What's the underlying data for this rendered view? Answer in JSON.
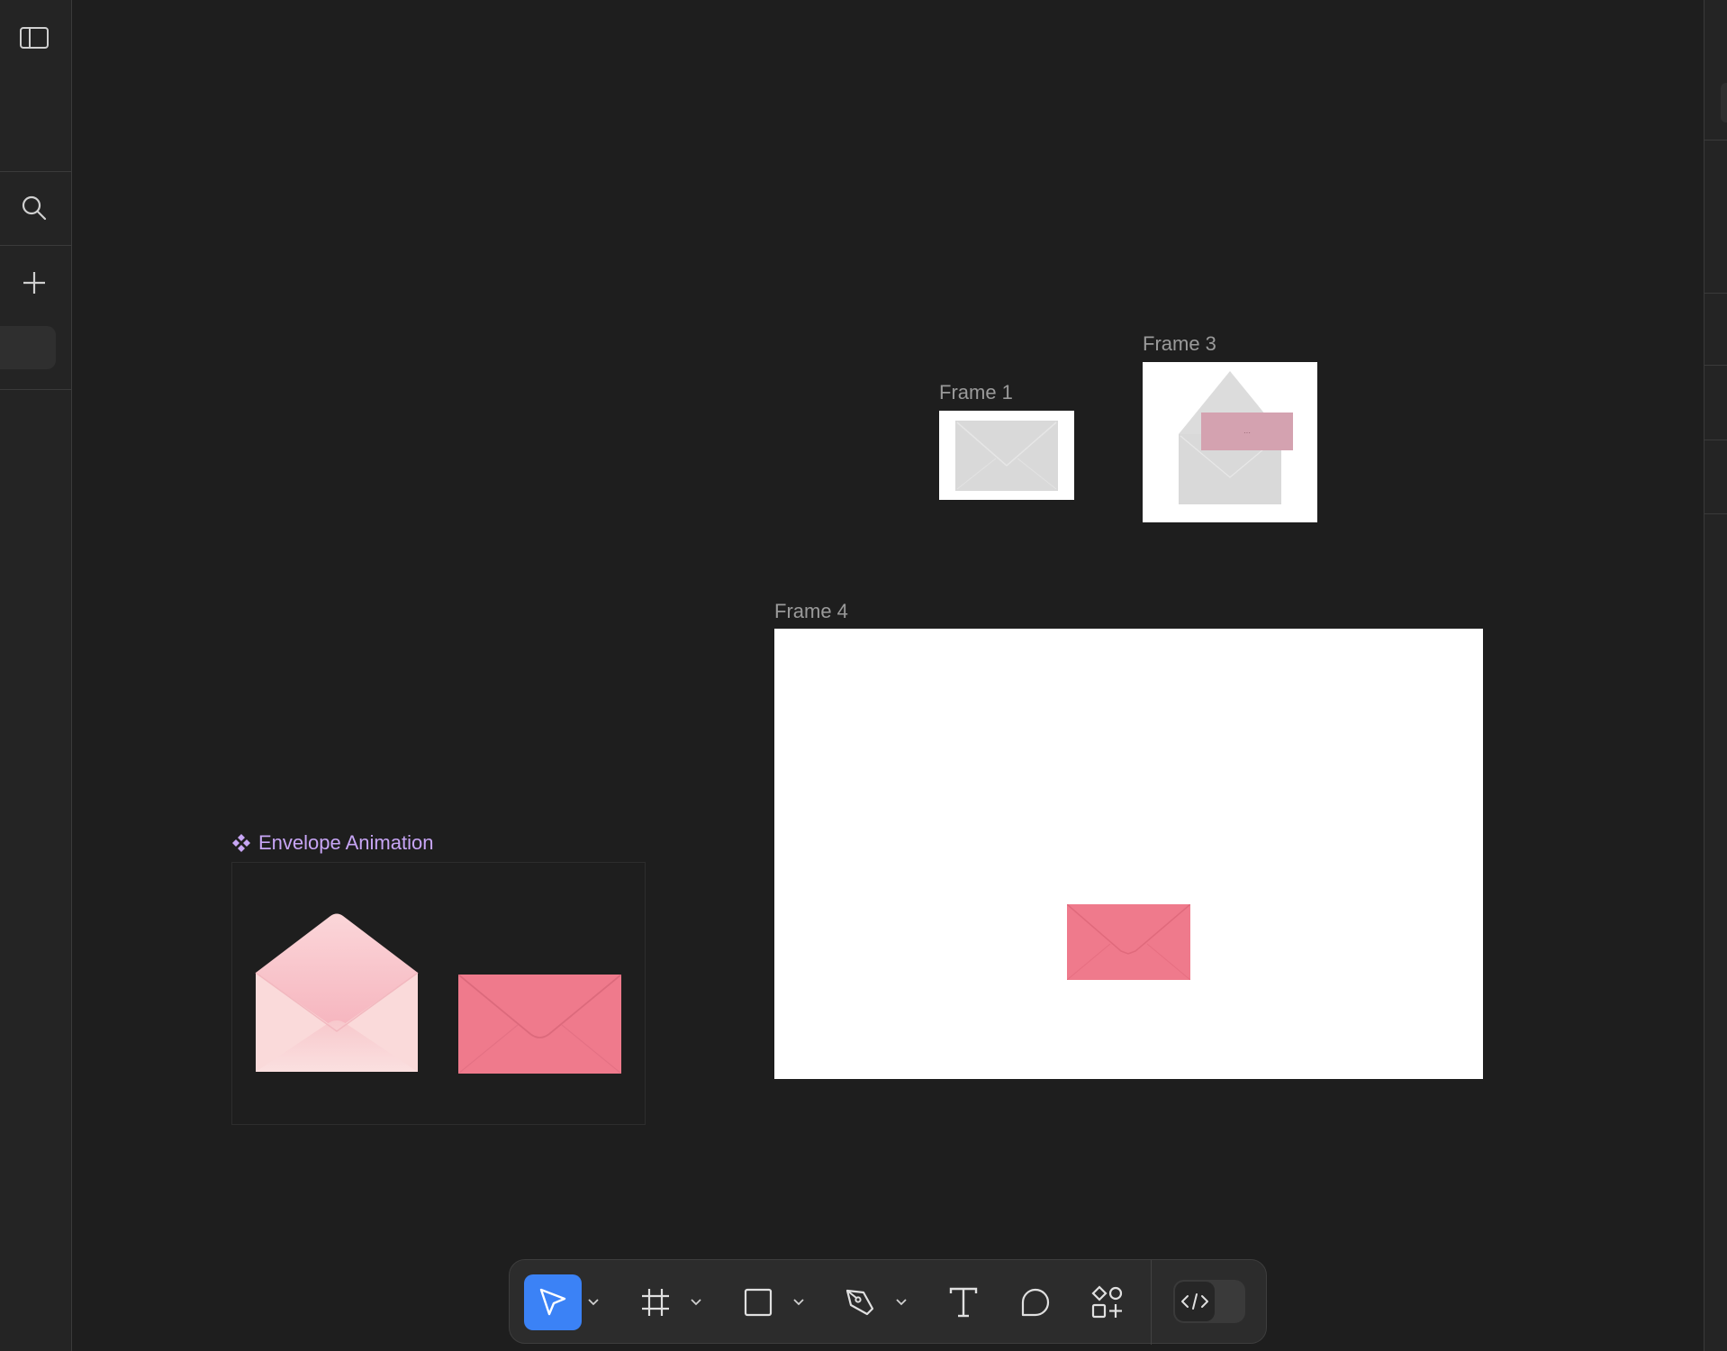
{
  "canvas": {
    "frames": [
      {
        "id": "frame1",
        "label": "Frame 1"
      },
      {
        "id": "frame3",
        "label": "Frame 3"
      },
      {
        "id": "frame4",
        "label": "Frame 4"
      }
    ],
    "component": {
      "label": "Envelope Animation",
      "icon": "component-diamond-icon"
    }
  },
  "left_rail": {
    "icons": [
      "panel-toggle-icon",
      "search-icon",
      "plus-icon"
    ]
  },
  "toolbar": {
    "tools": [
      {
        "name": "move-tool",
        "icon": "pointer-icon",
        "active": true
      },
      {
        "name": "frame-tool",
        "icon": "frame-hash-icon"
      },
      {
        "name": "shape-tool",
        "icon": "rectangle-icon"
      },
      {
        "name": "pen-tool",
        "icon": "pen-icon"
      },
      {
        "name": "text-tool",
        "icon": "text-icon"
      },
      {
        "name": "comment-tool",
        "icon": "comment-icon"
      },
      {
        "name": "actions-tool",
        "icon": "shapes-plus-icon"
      },
      {
        "name": "dev-mode-toggle",
        "icon": "code-icon"
      }
    ]
  },
  "colors": {
    "canvas": "#1e1e1e",
    "accent": "#3b82f6",
    "component": "#c7a5f5",
    "envelope_pink": "#ef7a8c",
    "envelope_light": "#f8cfd2"
  }
}
